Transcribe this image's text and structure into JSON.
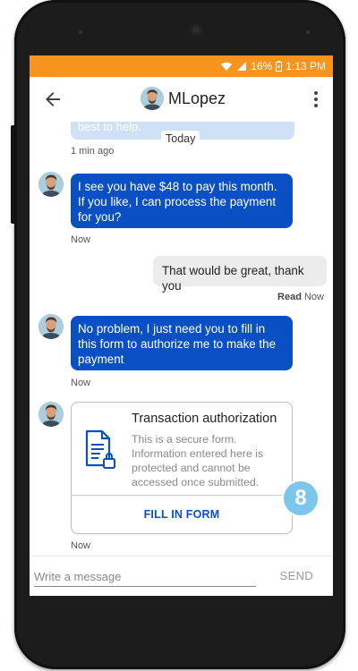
{
  "status_bar": {
    "battery": "16%",
    "time": "1:13 PM",
    "background_color": "#f7941d",
    "icons": [
      "wifi-icon",
      "signal-icon",
      "battery-icon"
    ]
  },
  "header": {
    "title": "MLopez",
    "back_icon": "arrow-left-icon",
    "menu_icon": "more-vert-icon"
  },
  "chat": {
    "previous_message_text": "best to help.",
    "previous_time": "1 min ago",
    "date_divider": "Today",
    "messages": [
      {
        "from": "agent",
        "text": "I see you have $48 to pay this month. If you like, I can process the payment for you?",
        "time": "Now"
      },
      {
        "from": "user",
        "text": "That would be great, thank you",
        "read": "Read",
        "time": "Now"
      },
      {
        "from": "agent",
        "text": "No problem, I just need you to fill in this form to authorize me to make the payment",
        "time": "Now"
      }
    ],
    "form_card": {
      "title": "Transaction authorization",
      "description": "This is a secure form. Information entered here is protected and cannot be accessed once submitted.",
      "button_label": "FILL IN FORM",
      "time": "Now",
      "icon": "secure-document-icon"
    },
    "step_badge": "8"
  },
  "composer": {
    "placeholder": "Write a message",
    "value": "",
    "send_label": "SEND"
  },
  "colors": {
    "accent_blue": "#0b4fc5",
    "incoming_bubble": "#0b4fc5",
    "outgoing_bubble": "#ececec",
    "badge": "#7cc6ec"
  }
}
